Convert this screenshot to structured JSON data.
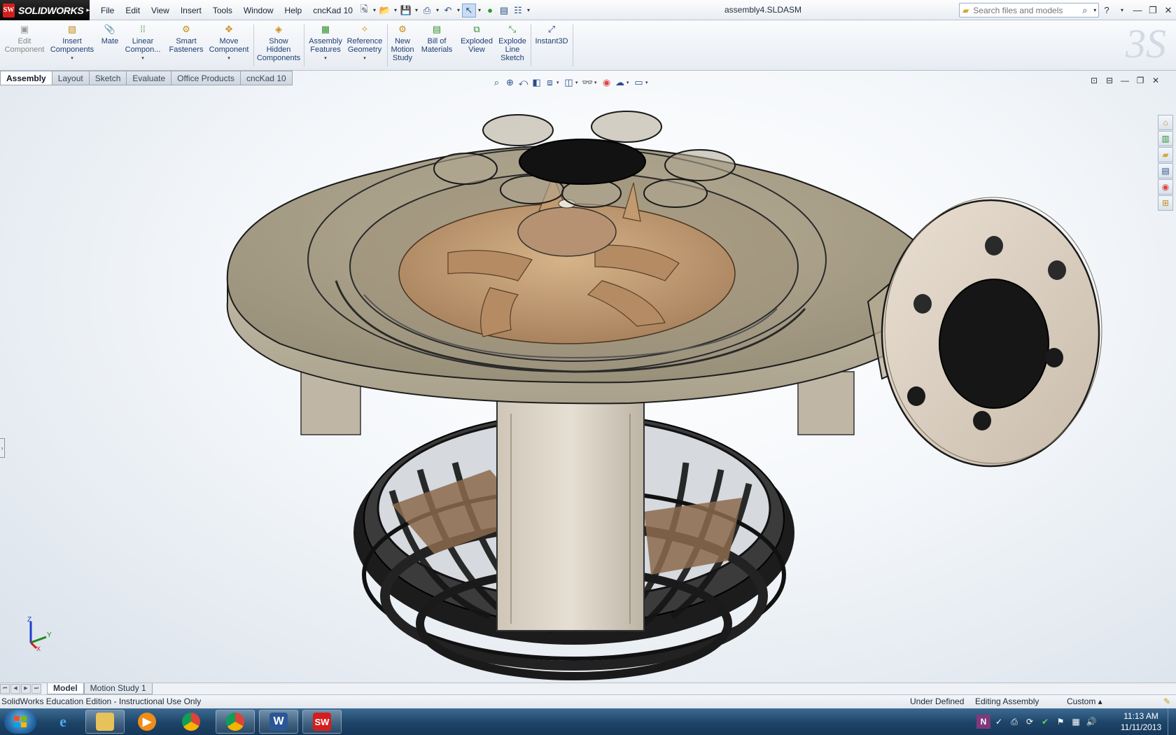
{
  "titlebar": {
    "app_name": "SOLIDWORKS",
    "menus": [
      "File",
      "Edit",
      "View",
      "Insert",
      "Tools",
      "Window",
      "Help",
      "cncKad 10"
    ],
    "document_title": "assembly4.SLDASM",
    "search_placeholder": "Search files and models",
    "help_label": "?"
  },
  "command_manager": {
    "tools": [
      {
        "label": "Edit\nComponent",
        "icon": "edit-component-icon",
        "disabled": true
      },
      {
        "label": "Insert\nComponents",
        "icon": "insert-components-icon"
      },
      {
        "label": "Mate",
        "icon": "mate-icon"
      },
      {
        "label": "Linear\nCompon...",
        "icon": "linear-pattern-icon"
      },
      {
        "label": "Smart\nFasteners",
        "icon": "smart-fasteners-icon"
      },
      {
        "label": "Move\nComponent",
        "icon": "move-component-icon"
      },
      {
        "label": "Show\nHidden\nComponents",
        "icon": "show-hidden-icon"
      },
      {
        "label": "Assembly\nFeatures",
        "icon": "assembly-features-icon"
      },
      {
        "label": "Reference\nGeometry",
        "icon": "reference-geometry-icon"
      },
      {
        "label": "New\nMotion\nStudy",
        "icon": "motion-study-icon"
      },
      {
        "label": "Bill of\nMaterials",
        "icon": "bom-icon"
      },
      {
        "label": "Exploded\nView",
        "icon": "exploded-view-icon"
      },
      {
        "label": "Explode\nLine\nSketch",
        "icon": "explode-line-icon"
      },
      {
        "label": "Instant3D",
        "icon": "instant3d-icon"
      }
    ]
  },
  "tabs": [
    "Assembly",
    "Layout",
    "Sketch",
    "Evaluate",
    "Office Products",
    "cncKad 10"
  ],
  "active_tab": "Assembly",
  "triad": {
    "x": "X",
    "y": "Y",
    "z": "Z"
  },
  "bottom_tabs": [
    "Model",
    "Motion Study 1"
  ],
  "status": {
    "left": "SolidWorks Education Edition - Instructional Use Only",
    "state": "Under Defined",
    "mode": "Editing Assembly",
    "units": "Custom"
  },
  "taskbar": {
    "clock_time": "11:13 AM",
    "clock_date": "11/11/2013"
  },
  "colors": {
    "accent": "#2b4d87",
    "housing": "#a39a84",
    "impeller": "#c79e74",
    "sw_red": "#d41e1e"
  }
}
